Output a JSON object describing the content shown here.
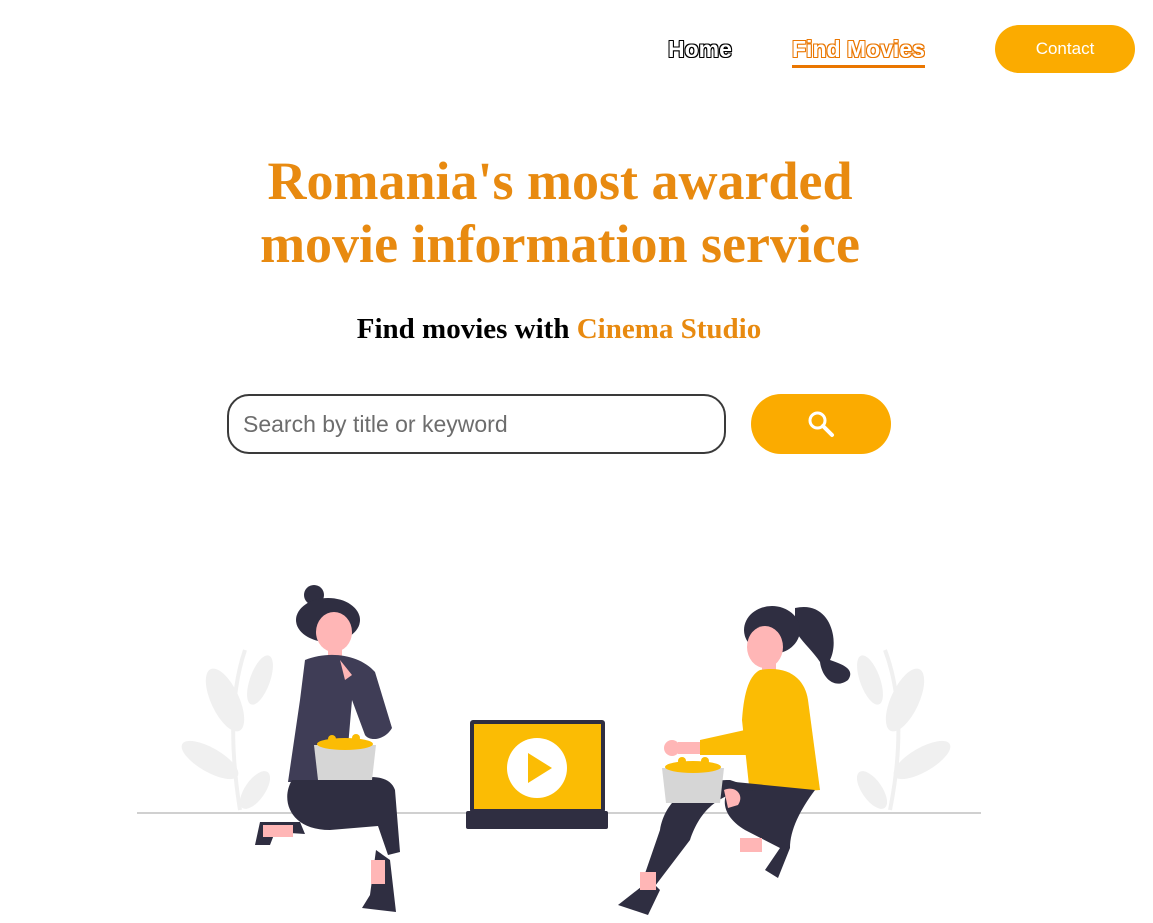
{
  "nav": {
    "home_label": "Home",
    "find_movies_label": "Find Movies",
    "contact_label": "Contact"
  },
  "hero": {
    "title_line1": "Romania's most awarded",
    "title_line2": "movie information service",
    "subtitle_prefix": "Find movies with",
    "subtitle_brand": "Cinema Studio"
  },
  "search": {
    "placeholder": "Search by title or keyword",
    "value": "",
    "button_icon": "search-icon"
  },
  "illustration": {
    "play_icon": "play-icon",
    "description_icons": [
      "person-left",
      "person-right",
      "laptop",
      "popcorn-bowl",
      "plant"
    ]
  },
  "colors": {
    "accent": "#fbab00",
    "title_orange": "#e88a10",
    "nav_active_outline": "#ea7600",
    "dark_figure": "#2f2e41",
    "skin": "#ffb6b6",
    "popcorn_bowl": "#d6d6d6",
    "plant": "#f0f0f0"
  }
}
